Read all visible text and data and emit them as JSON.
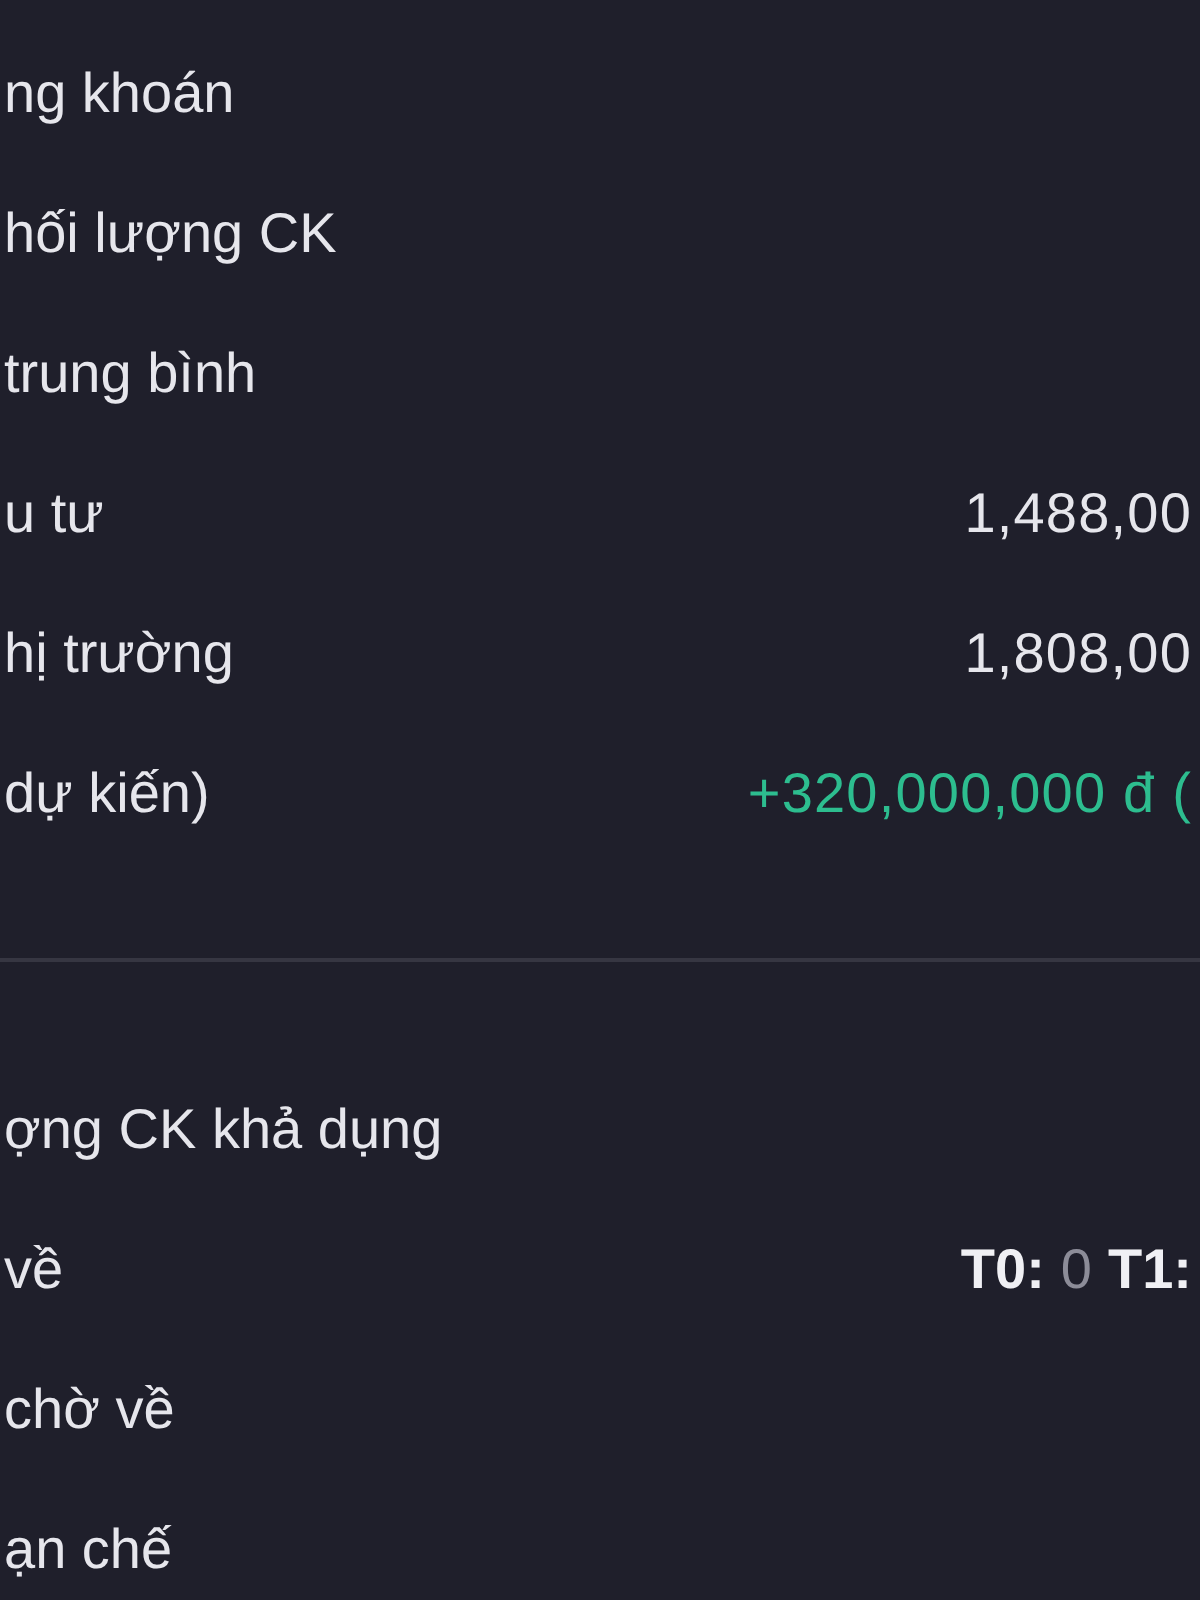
{
  "sections": [
    {
      "rows": [
        {
          "label": "ng khoán"
        },
        {
          "label": "hối lượng CK"
        },
        {
          "label": "trung bình"
        },
        {
          "label": "u tư",
          "value": "1,488,00",
          "positive": false
        },
        {
          "label": "hị trường",
          "value": "1,808,00",
          "positive": false
        },
        {
          "label": "dự kiến)",
          "value": "+320,000,000 đ (",
          "positive": true
        }
      ]
    },
    {
      "rows": [
        {
          "label": "ợng CK khả dụng"
        },
        {
          "label": "về",
          "parts": [
            {
              "label": "T0:",
              "value": "0"
            },
            {
              "label": "T1:"
            }
          ]
        },
        {
          "label": "chờ về"
        },
        {
          "label": "ạn chế"
        }
      ]
    }
  ]
}
